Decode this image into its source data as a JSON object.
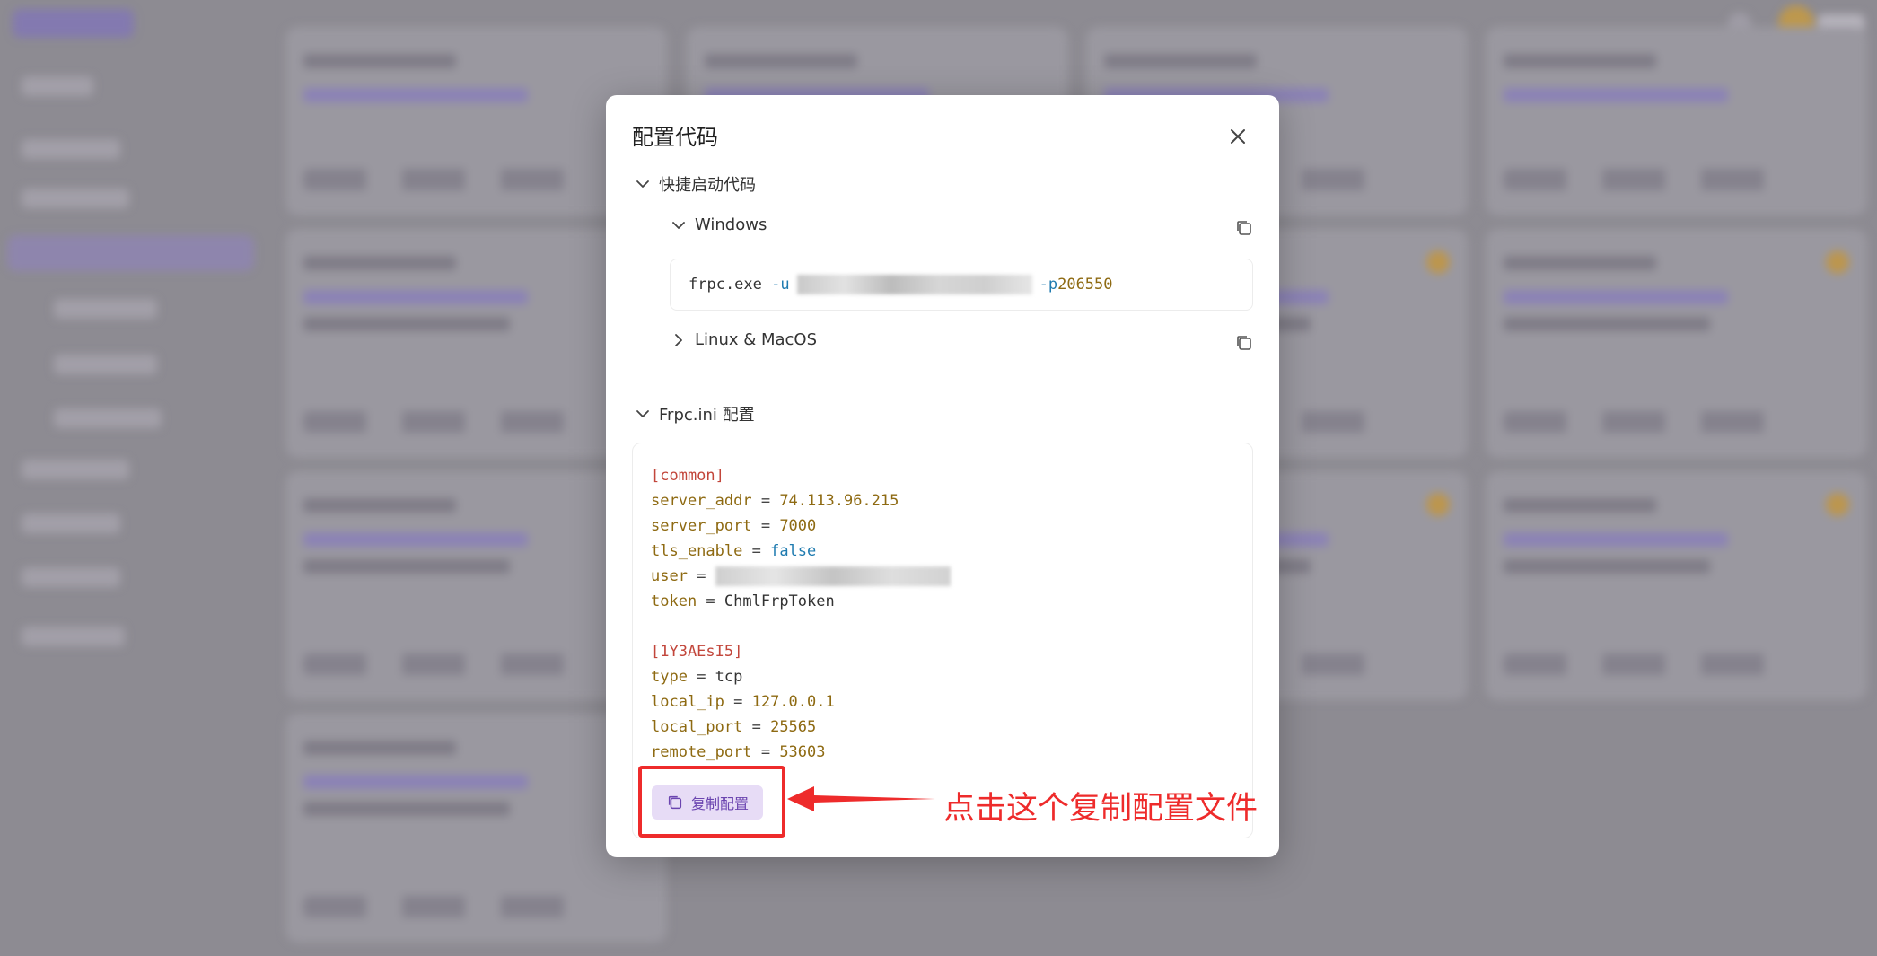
{
  "modal": {
    "title": "配置代码",
    "close_icon": "close-icon"
  },
  "quick_start": {
    "label": "快捷启动代码",
    "windows": {
      "label": "Windows",
      "cmd_prefix": "frpc.exe ",
      "flag_u": "-u",
      "flag_p": "-p",
      "port": "206550"
    },
    "linux": {
      "label": "Linux & MacOS"
    }
  },
  "frpc_ini": {
    "label": "Frpc.ini 配置",
    "lines": [
      {
        "type": "section",
        "text": "[common]"
      },
      {
        "type": "kv",
        "key": "server_addr",
        "value": "74.113.96.215",
        "vtype": "num"
      },
      {
        "type": "kv",
        "key": "server_port",
        "value": "7000",
        "vtype": "num"
      },
      {
        "type": "kv",
        "key": "tls_enable",
        "value": "false",
        "vtype": "bool"
      },
      {
        "type": "kv",
        "key": "user",
        "value": "",
        "vtype": "blur"
      },
      {
        "type": "kv",
        "key": "token",
        "value": "ChmlFrpToken",
        "vtype": "str"
      },
      {
        "type": "blank"
      },
      {
        "type": "section",
        "text": "[1Y3AEsI5]"
      },
      {
        "type": "kv",
        "key": "type",
        "value": "tcp",
        "vtype": "str"
      },
      {
        "type": "kv",
        "key": "local_ip",
        "value": "127.0.0.1",
        "vtype": "num"
      },
      {
        "type": "kv",
        "key": "local_port",
        "value": "25565",
        "vtype": "num"
      },
      {
        "type": "kv",
        "key": "remote_port",
        "value": "53603",
        "vtype": "num"
      }
    ],
    "copy_button": "复制配置"
  },
  "annotation": {
    "text": "点击这个复制配置文件",
    "color": "#ee2b2b"
  },
  "colors": {
    "accent": "#6b45b0",
    "button_bg": "#e7dcf6",
    "ini_section": "#c2463b",
    "ini_key": "#8e6a12",
    "ini_bool": "#1f7bb0"
  }
}
